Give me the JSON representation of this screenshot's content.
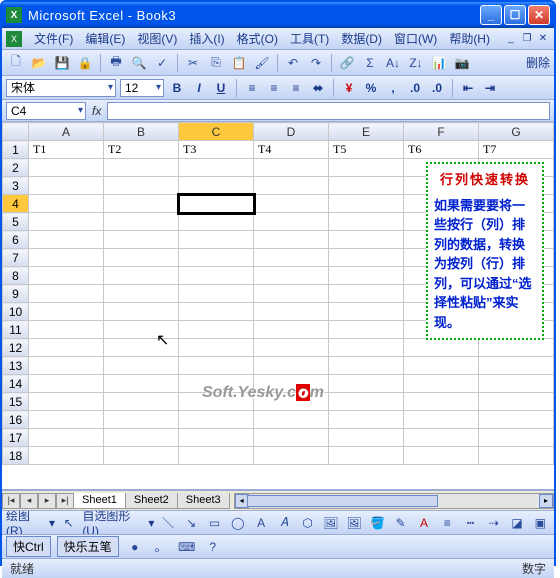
{
  "window": {
    "title": "Microsoft Excel - Book3"
  },
  "menu": {
    "file": "文件(F)",
    "edit": "编辑(E)",
    "view": "视图(V)",
    "insert": "插入(I)",
    "format": "格式(O)",
    "tools": "工具(T)",
    "data": "数据(D)",
    "window": "窗口(W)",
    "help": "帮助(H)"
  },
  "format_bar": {
    "font": "宋体",
    "size": "12"
  },
  "name_box": {
    "cell": "C4",
    "fx": "fx"
  },
  "columns": [
    "A",
    "B",
    "C",
    "D",
    "E",
    "F",
    "G"
  ],
  "row1": [
    "T1",
    "T2",
    "T3",
    "T4",
    "T5",
    "T6",
    "T7"
  ],
  "row_count": 18,
  "textbox": {
    "title": "行列快速转换",
    "body": "如果需要要将一些按行（列）排列的数据，转换为按列（行）排列，可以通过“选择性粘贴”来实现。"
  },
  "sheets": {
    "s1": "Sheet1",
    "s2": "Sheet2",
    "s3": "Sheet3"
  },
  "drawing": {
    "label": "绘图(R)",
    "auto": "自选图形(U)"
  },
  "taskbar": {
    "ime_toggle": "快Ctrl",
    "ime": "快乐五笔"
  },
  "status": {
    "ready": "就绪",
    "mode": "数字"
  },
  "toolbar_extra": "删除",
  "watermark": {
    "a": "Soft.",
    "b": "Yesky",
    "c": ".c",
    "d": "o",
    "e": "m"
  }
}
